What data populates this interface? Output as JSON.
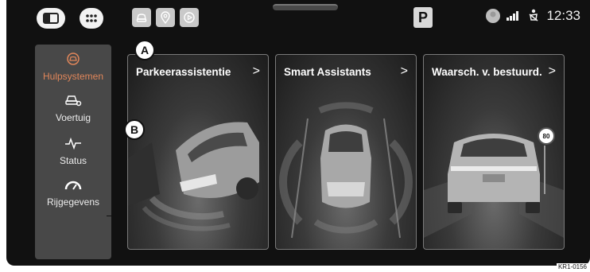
{
  "topbar": {
    "clock": "12:33",
    "gear_badge": "P"
  },
  "sidebar": {
    "items": [
      {
        "label": "Hulpsystemen",
        "icon": "assist-car-icon",
        "active": true
      },
      {
        "label": "Voertuig",
        "icon": "car-settings-icon",
        "active": false
      },
      {
        "label": "Status",
        "icon": "pulse-icon",
        "active": false
      },
      {
        "label": "Rijgegevens",
        "icon": "gauge-icon",
        "active": false
      }
    ]
  },
  "cards": [
    {
      "title": "Parkeerassistentie",
      "arrow": ">"
    },
    {
      "title": "Smart Assistants",
      "arrow": ">"
    },
    {
      "title": "Waarsch. v. bestuurd.",
      "arrow": ">",
      "speed_sign": "80"
    }
  ],
  "callouts": {
    "a": "A",
    "b": "B"
  },
  "figure_ref": "KR1-0156",
  "colors": {
    "accent": "#e0865a",
    "screen_bg": "#111111",
    "sidebar_bg": "#484848"
  }
}
